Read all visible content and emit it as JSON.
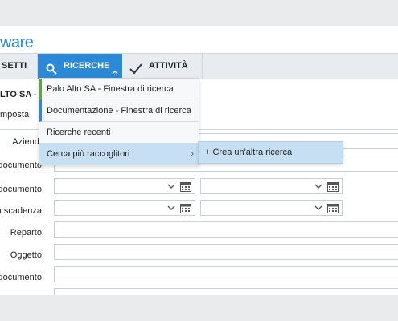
{
  "app": {
    "brand": "ware"
  },
  "toolbar": {
    "settings_label": "SETTI",
    "search_label": "RICERCHE",
    "activity_label": "ATTIVITÀ"
  },
  "header": {
    "title": "LTO SA - FI",
    "subtab": "mposta"
  },
  "search_menu": {
    "items": [
      "Palo Alto SA - Finestra di ricerca",
      "Documentazione - Finestra di ricerca",
      "Ricerche recenti",
      "Cerca più raccoglitori"
    ],
    "submenu": [
      "+ Crea un'altra ricerca"
    ]
  },
  "form": {
    "labels": [
      "Azienda",
      "documento:",
      "documento:",
      "a scadenza:",
      "Reparto:",
      "Oggetto:",
      "documento:"
    ]
  },
  "colors": {
    "accent": "#2a8ad8",
    "menu_hover": "#c6dff2",
    "marker_green": "#5aa839"
  }
}
